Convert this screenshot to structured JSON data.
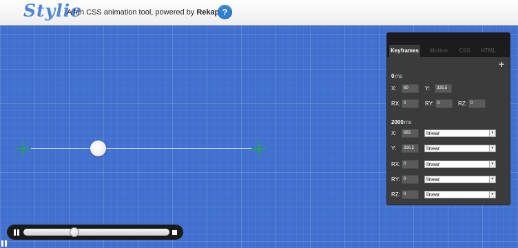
{
  "header": {
    "logo": "Stylie",
    "tagline_prefix": "A fun CSS animation tool, powered by ",
    "tagline_brand": "Rekapi",
    "help_label": "?"
  },
  "panel": {
    "tabs": [
      "Keyframes",
      "Motion",
      "CSS",
      "HTML"
    ],
    "active_tab": "Keyframes",
    "add_label": "+",
    "unit": "ms",
    "keyframe1": {
      "time": "0",
      "x_label": "X:",
      "x": "60",
      "y_label": "Y:",
      "y": "326.5",
      "rx_label": "RX:",
      "rx": "0",
      "ry_label": "RY:",
      "ry": "0",
      "rz_label": "RZ:",
      "rz": "0"
    },
    "keyframe2": {
      "time": "2000",
      "rows": [
        {
          "label": "X:",
          "value": "683",
          "easing": "linear"
        },
        {
          "label": "Y:",
          "value": "326.5",
          "easing": "linear"
        },
        {
          "label": "RX:",
          "value": "0",
          "easing": "linear"
        },
        {
          "label": "RY:",
          "value": "0",
          "easing": "linear"
        },
        {
          "label": "RZ:",
          "value": "0",
          "easing": "linear"
        }
      ]
    }
  },
  "timeline": {
    "progress": 0.34,
    "state": "playing"
  },
  "icons": {
    "help": "help-icon",
    "add": "plus-icon",
    "pause": "pause-icon",
    "stop": "stop-icon",
    "dropdown": "chevron-down-icon",
    "crosshair": "crosshair-icon"
  },
  "colors": {
    "stage_bg": "#4170cf",
    "crosshair": "#22a35a",
    "panel_bg": "#3b3b3b",
    "logo": "#4f86d8",
    "help_button": "#2f7fd6"
  }
}
